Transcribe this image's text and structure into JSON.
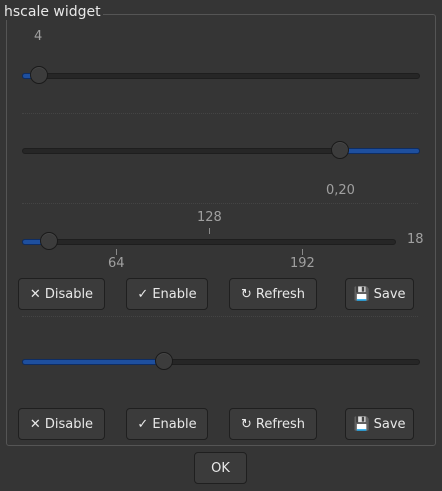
{
  "frame": {
    "title": "hscale widget"
  },
  "scales": [
    {
      "value_label": "4",
      "value": 4,
      "min": 0,
      "max": 100
    },
    {
      "value_label": "0,20",
      "value": 0.2,
      "min": 1,
      "max": 0,
      "inverted": true
    },
    {
      "value_label": "18",
      "value": 18,
      "min": 0,
      "max": 256,
      "marks": [
        {
          "label": "128"
        },
        {
          "label": "64"
        },
        {
          "label": "192"
        }
      ]
    },
    {
      "value": 40,
      "min": 0,
      "max": 100
    }
  ],
  "buttons": {
    "disable": "Disable",
    "enable": "Enable",
    "refresh": "Refresh",
    "save": "Save"
  },
  "dialog": {
    "ok": "OK"
  },
  "accent_color": "#1e4f9e"
}
